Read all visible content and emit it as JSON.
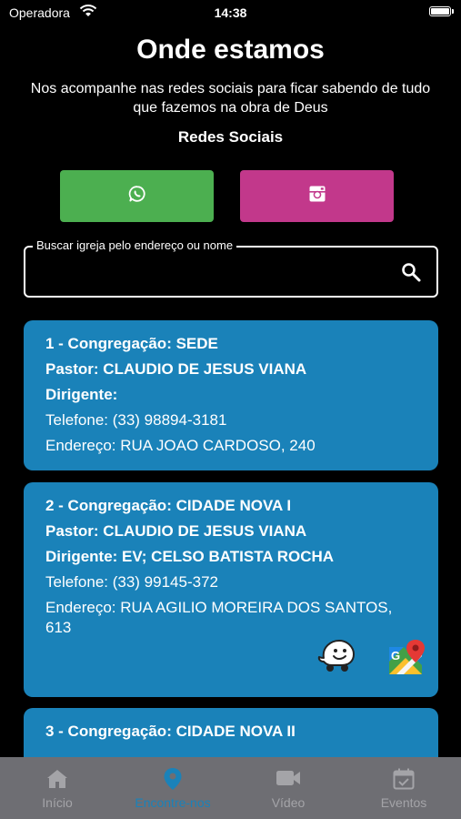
{
  "status_bar": {
    "carrier": "Operadora",
    "time": "14:38"
  },
  "header": {
    "title": "Onde estamos",
    "subtitle": "Nos acompanhe nas redes sociais para ficar sabendo de tudo que fazemos na obra de Deus",
    "social_title": "Redes Sociais"
  },
  "social": [
    {
      "icon": "whatsapp-icon",
      "color": "#4caf50"
    },
    {
      "icon": "instagram-icon",
      "color": "#c2388b"
    }
  ],
  "search": {
    "label": "Buscar igreja pelo endereço ou nome",
    "value": "",
    "placeholder": ""
  },
  "congregations": [
    {
      "congregation": "1 - Congregação: SEDE",
      "pastor": "Pastor: CLAUDIO DE JESUS VIANA",
      "dirigente": "Dirigente:",
      "telefone": "Telefone: (33) 98894-3181",
      "endereco": "Endereço: RUA JOAO CARDOSO, 240"
    },
    {
      "congregation": "2 - Congregação: CIDADE NOVA I",
      "pastor": "Pastor: CLAUDIO DE JESUS VIANA",
      "dirigente": "Dirigente: EV; CELSO BATISTA ROCHA",
      "telefone": "Telefone: (33) 99145-372",
      "endereco": "Endereço: RUA AGILIO MOREIRA DOS SANTOS, 613"
    },
    {
      "congregation": "3 - Congregação: CIDADE NOVA II"
    }
  ],
  "tabbar": {
    "tabs": [
      {
        "label": "Início",
        "icon": "home-icon"
      },
      {
        "label": "Encontre-nos",
        "icon": "location-pin-icon",
        "active": true
      },
      {
        "label": "Vídeo",
        "icon": "video-camera-icon"
      },
      {
        "label": "Eventos",
        "icon": "calendar-icon"
      }
    ]
  },
  "colors": {
    "accent": "#1a82b9",
    "whatsapp": "#4caf50",
    "instagram": "#c2388b",
    "tabbar": "#6e6e73"
  }
}
